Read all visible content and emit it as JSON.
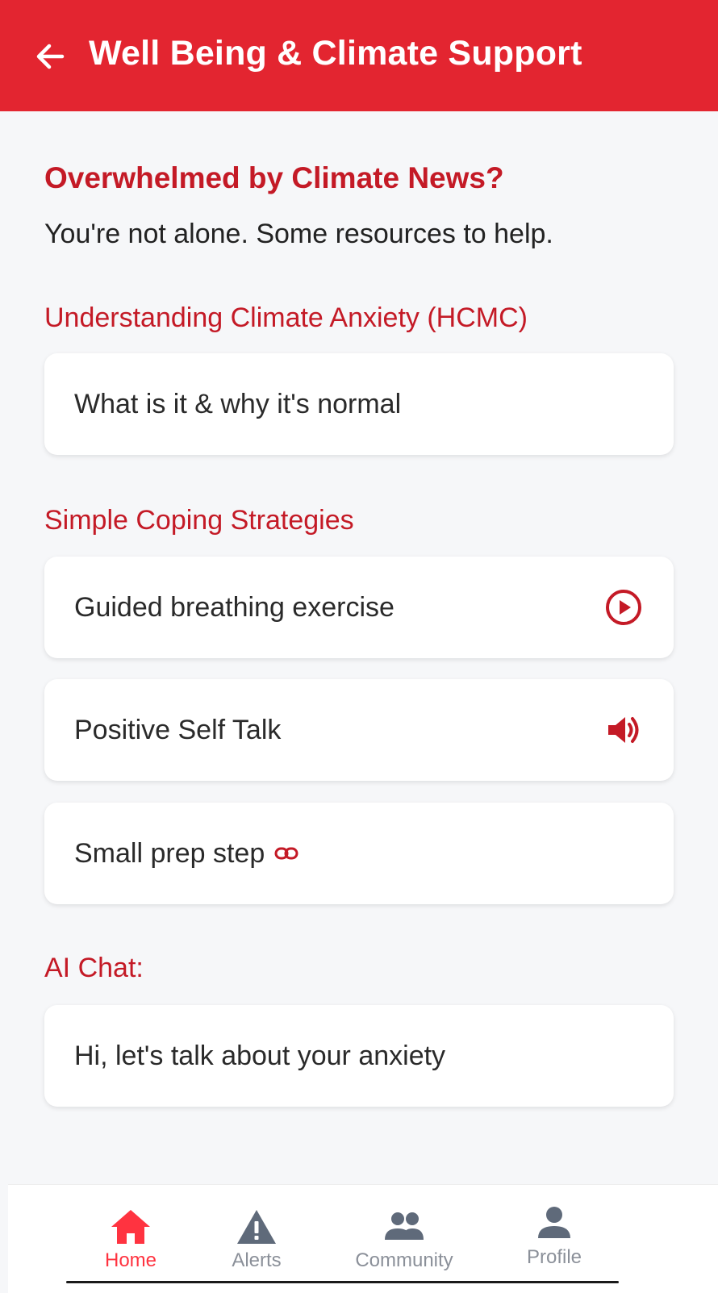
{
  "header": {
    "title": "Well Being & Climate Support",
    "back_icon": "arrow-left-icon",
    "color": "#e32530"
  },
  "intro": {
    "headline": "Overwhelmed by Climate News?",
    "subline": "You're not alone. Some resources to help."
  },
  "sections": {
    "understanding": {
      "title": "Understanding Climate Anxiety (HCMC)",
      "card": "What is it & why it's normal"
    },
    "coping": {
      "title": "Simple Coping Strategies",
      "cards": [
        {
          "label": "Guided breathing exercise",
          "icon": "play-circle-icon"
        },
        {
          "label": "Positive Self Talk",
          "icon": "speaker-icon"
        },
        {
          "label": "Small prep step",
          "icon": "link-icon"
        }
      ]
    },
    "ai_chat": {
      "title": "AI Chat:",
      "card": "Hi, let's talk about your anxiety"
    }
  },
  "bottom_nav": {
    "items": [
      {
        "label": "Home",
        "icon": "home-icon",
        "active": true
      },
      {
        "label": "Alerts",
        "icon": "warning-icon",
        "active": false
      },
      {
        "label": "Community",
        "icon": "people-icon",
        "active": false
      },
      {
        "label": "Profile",
        "icon": "person-icon",
        "active": false
      }
    ]
  },
  "colors": {
    "accent": "#c41a26",
    "active_nav": "#ff3340",
    "inactive_nav": "#8b9099",
    "background": "#f6f7f9"
  }
}
